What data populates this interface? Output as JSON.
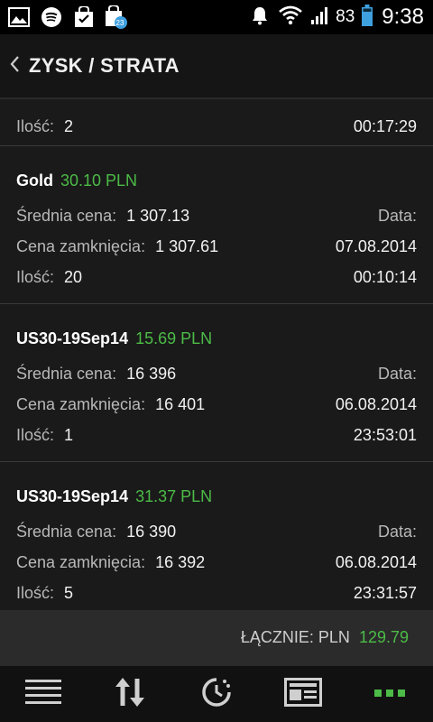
{
  "status_bar": {
    "icons_left": [
      "image-icon",
      "spotify-icon",
      "shopping-bag-icon",
      "calendar-icon"
    ],
    "calendar_badge": "23",
    "battery_percent": "83",
    "time": "9:38"
  },
  "header": {
    "title": "ZYSK / STRATA"
  },
  "partial_item": {
    "qty_label": "Ilość:",
    "qty_value": "2",
    "time": "00:17:29"
  },
  "items": [
    {
      "symbol": "Gold",
      "pnl": "30.10 PLN",
      "avg_label": "Średnia cena:",
      "avg_value": "1 307.13",
      "date_label": "Data:",
      "close_label": "Cena zamknięcia:",
      "close_value": "1 307.61",
      "date": "07.08.2014",
      "qty_label": "Ilość:",
      "qty_value": "20",
      "time": "00:10:14"
    },
    {
      "symbol": "US30-19Sep14",
      "pnl": "15.69 PLN",
      "avg_label": "Średnia cena:",
      "avg_value": "16 396",
      "date_label": "Data:",
      "close_label": "Cena zamknięcia:",
      "close_value": "16 401",
      "date": "06.08.2014",
      "qty_label": "Ilość:",
      "qty_value": "1",
      "time": "23:53:01"
    },
    {
      "symbol": "US30-19Sep14",
      "pnl": "31.37 PLN",
      "avg_label": "Średnia cena:",
      "avg_value": "16 390",
      "date_label": "Data:",
      "close_label": "Cena zamknięcia:",
      "close_value": "16 392",
      "date": "06.08.2014",
      "qty_label": "Ilość:",
      "qty_value": "5",
      "time": "23:31:57"
    }
  ],
  "total": {
    "label": "ŁĄCZNIE: PLN",
    "value": "129.79"
  },
  "bottom_nav": [
    "menu-icon",
    "sort-arrows-icon",
    "history-clock-icon",
    "news-icon",
    "more-dots-icon"
  ],
  "colors": {
    "profit": "#4cbb47",
    "background": "#1a1a1a",
    "total_bar": "#2b2b2b"
  }
}
